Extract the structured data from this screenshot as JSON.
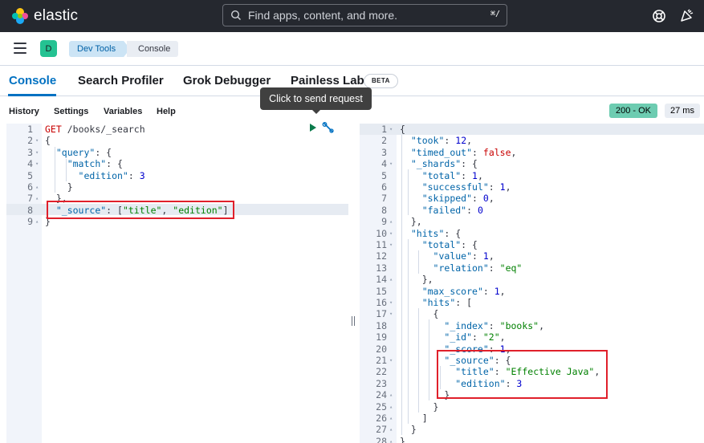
{
  "header": {
    "brand": "elastic",
    "search_placeholder": "Find apps, content, and more.",
    "search_shortcut": "⌘/"
  },
  "breadcrumbs": {
    "space": "D",
    "items": [
      "Dev Tools",
      "Console"
    ]
  },
  "tabs": [
    {
      "label": "Console",
      "active": true
    },
    {
      "label": "Search Profiler"
    },
    {
      "label": "Grok Debugger"
    },
    {
      "label": "Painless Lab",
      "badge": "BETA"
    }
  ],
  "menu": [
    "History",
    "Settings",
    "Variables",
    "Help"
  ],
  "tooltip": "Click to send request",
  "response_status": {
    "code": "200 - OK",
    "time": "27 ms"
  },
  "request": {
    "lines": [
      {
        "n": "1",
        "fold": ""
      },
      {
        "n": "2",
        "fold": "▾"
      },
      {
        "n": "3",
        "fold": "▾"
      },
      {
        "n": "4",
        "fold": "▾"
      },
      {
        "n": "5",
        "fold": ""
      },
      {
        "n": "6",
        "fold": "▴"
      },
      {
        "n": "7",
        "fold": "▴"
      },
      {
        "n": "8",
        "fold": ""
      },
      {
        "n": "9",
        "fold": "▴"
      }
    ],
    "method": "GET",
    "url": "/books/_search",
    "code": {
      "l2": "{",
      "l3_key": "\"query\"",
      "l3_rest": ": {",
      "l4_key": "\"match\"",
      "l4_rest": ": {",
      "l5_key": "\"edition\"",
      "l5_sep": ": ",
      "l5_val": "3",
      "l6": "}",
      "l7": "},",
      "l8_key": "\"_source\"",
      "l8_sep": ": [",
      "l8_v1": "\"title\"",
      "l8_comma": ", ",
      "l8_v2": "\"edition\"",
      "l8_end": "]",
      "l9": "}"
    }
  },
  "response": {
    "line_numbers": [
      "1",
      "2",
      "3",
      "4",
      "5",
      "6",
      "7",
      "8",
      "9",
      "10",
      "11",
      "12",
      "13",
      "14",
      "15",
      "16",
      "17",
      "18",
      "19",
      "20",
      "21",
      "22",
      "23",
      "24",
      "25",
      "26",
      "27",
      "28"
    ],
    "folds": [
      "▾",
      "",
      "",
      "▾",
      "",
      "",
      "",
      "",
      "▴",
      "▾",
      "▾",
      "",
      "",
      "▴",
      "",
      "▾",
      "▾",
      "",
      "",
      "",
      "▾",
      "",
      "",
      "▴",
      "▴",
      "▴",
      "▴",
      "▴"
    ],
    "code": {
      "l1": "{",
      "l2_key": "\"took\"",
      "l2_val": "12",
      "l3_key": "\"timed_out\"",
      "l3_val": "false",
      "l4_key": "\"_shards\"",
      "l4_rest": ": {",
      "l5_key": "\"total\"",
      "l5_val": "1",
      "l6_key": "\"successful\"",
      "l6_val": "1",
      "l7_key": "\"skipped\"",
      "l7_val": "0",
      "l8_key": "\"failed\"",
      "l8_val": "0",
      "l9": "},",
      "l10_key": "\"hits\"",
      "l10_rest": ": {",
      "l11_key": "\"total\"",
      "l11_rest": ": {",
      "l12_key": "\"value\"",
      "l12_val": "1",
      "l13_key": "\"relation\"",
      "l13_val": "\"eq\"",
      "l14": "},",
      "l15_key": "\"max_score\"",
      "l15_val": "1",
      "l16_key": "\"hits\"",
      "l16_rest": ": [",
      "l17": "{",
      "l18_key": "\"_index\"",
      "l18_val": "\"books\"",
      "l19_key": "\"_id\"",
      "l19_val": "\"2\"",
      "l20_key": "\"_score\"",
      "l20_val": "1",
      "l21_key": "\"_source\"",
      "l21_rest": ": {",
      "l22_key": "\"title\"",
      "l22_val": "\"Effective Java\"",
      "l23_key": "\"edition\"",
      "l23_val": "3",
      "l24": "}",
      "l25": "}",
      "l26": "]",
      "l27": "}",
      "l28": "}"
    }
  },
  "colors": {
    "header_bg": "#25282f",
    "accent": "#0071c2",
    "status_ok_bg": "#6dccb1",
    "highlight_border": "#e0202b"
  }
}
